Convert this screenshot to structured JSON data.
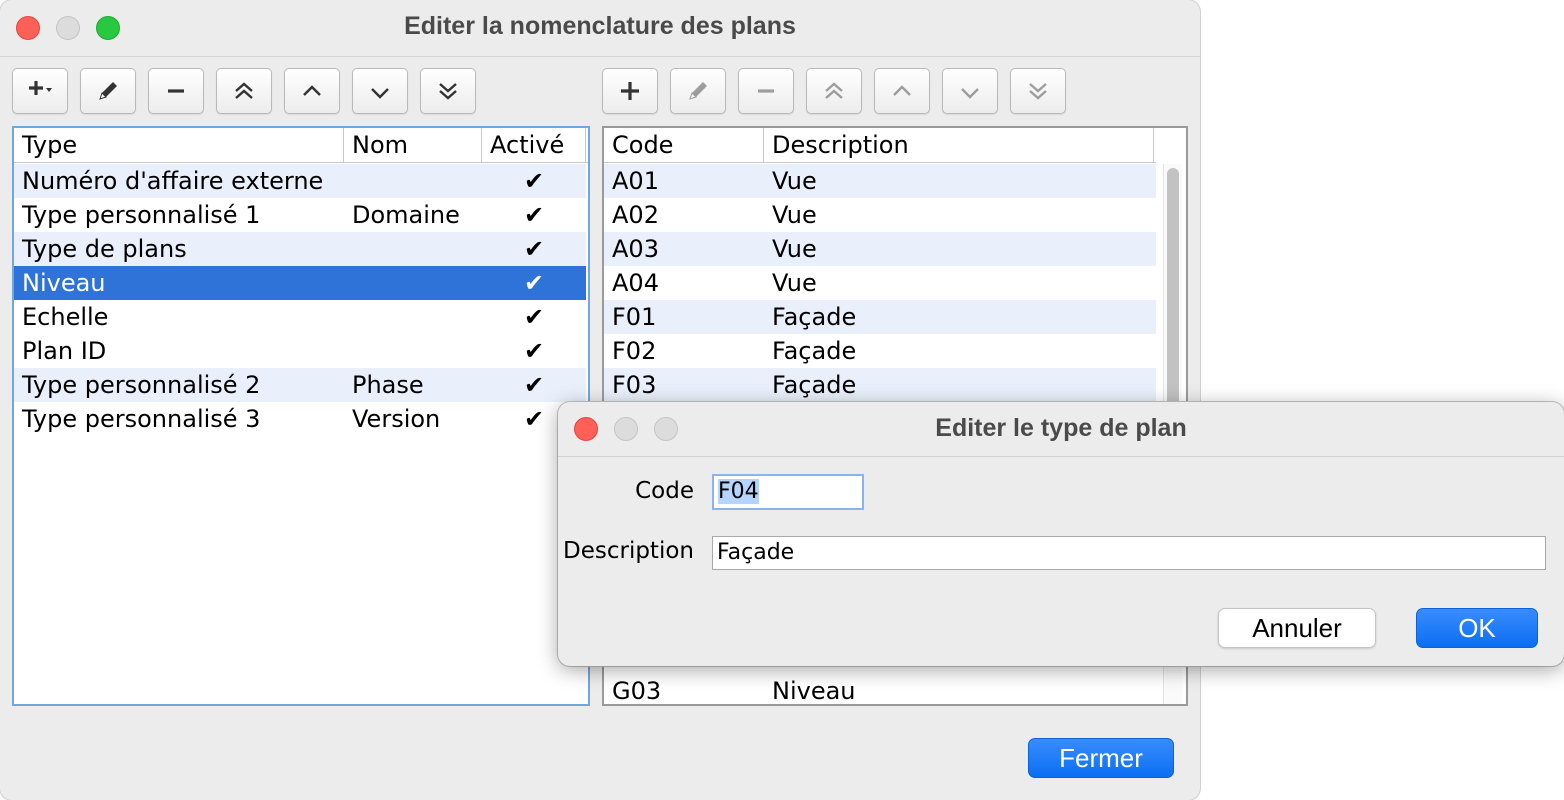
{
  "main_window": {
    "title": "Editer la nomenclature des plans",
    "close_label": "Fermer"
  },
  "left_table": {
    "columns": [
      "Type",
      "Nom",
      "Activé"
    ],
    "rows": [
      {
        "type": "Numéro d'affaire externe",
        "nom": "",
        "active": "✔"
      },
      {
        "type": "Type personnalisé 1",
        "nom": "Domaine",
        "active": "✔"
      },
      {
        "type": "Type de plans",
        "nom": "",
        "active": "✔"
      },
      {
        "type": "Niveau",
        "nom": "",
        "active": "✔"
      },
      {
        "type": "Echelle",
        "nom": "",
        "active": "✔"
      },
      {
        "type": "Plan ID",
        "nom": "",
        "active": "✔"
      },
      {
        "type": "Type personnalisé 2",
        "nom": "Phase",
        "active": "✔"
      },
      {
        "type": "Type personnalisé 3",
        "nom": "Version",
        "active": "✔"
      }
    ]
  },
  "right_table": {
    "columns": [
      "Code",
      "Description"
    ],
    "rows": [
      {
        "code": "A01",
        "description": "Vue"
      },
      {
        "code": "A02",
        "description": "Vue"
      },
      {
        "code": "A03",
        "description": "Vue"
      },
      {
        "code": "A04",
        "description": "Vue"
      },
      {
        "code": "F01",
        "description": "Façade"
      },
      {
        "code": "F02",
        "description": "Façade"
      },
      {
        "code": "F03",
        "description": "Façade"
      }
    ],
    "last_row": {
      "code": "G03",
      "description": "Niveau"
    }
  },
  "dialog": {
    "title": "Editer le type de plan",
    "code_label": "Code",
    "code_value": "F04",
    "description_label": "Description",
    "description_value": "Façade",
    "cancel_label": "Annuler",
    "ok_label": "OK"
  },
  "colors": {
    "selection": "#2f73d8",
    "primary_button": "#0a6ff2",
    "row_alt": "#e9f0fb"
  }
}
